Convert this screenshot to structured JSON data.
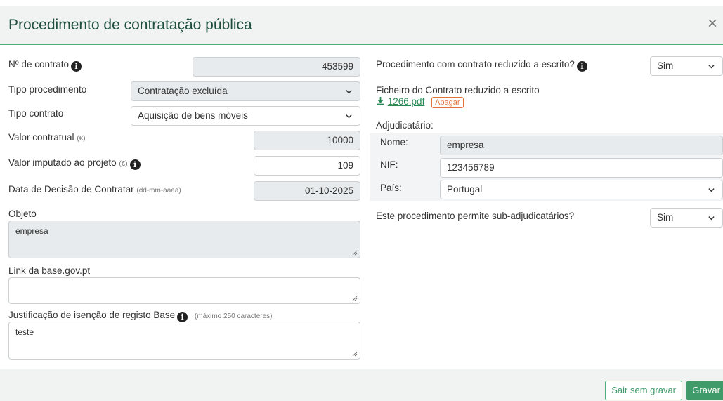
{
  "dialog": {
    "title": "Procedimento de contratação pública",
    "close_glyph": "×"
  },
  "left": {
    "contract_no": {
      "label": "Nº de contrato",
      "value": "453599"
    },
    "proc_type": {
      "label": "Tipo procedimento",
      "value": "Contratação excluída"
    },
    "contract_type": {
      "label": "Tipo contrato",
      "value": "Aquisição de bens móveis"
    },
    "contract_value": {
      "label": "Valor contratual",
      "unit": "(€)",
      "value": "10000"
    },
    "imputed_value": {
      "label": "Valor imputado ao projeto",
      "unit": "(€)",
      "value": "109"
    },
    "decision_date": {
      "label": "Data de Decisão de Contratar",
      "hint": "(dd-mm-aaaa)",
      "value": "01-10-2025"
    },
    "object": {
      "label": "Objeto",
      "value": "empresa"
    },
    "base_link": {
      "label": "Link da base.gov.pt",
      "value": ""
    },
    "justification": {
      "label": "Justificação de isenção de registo Base",
      "hint": "(máximo 250 caracteres)",
      "value": "teste"
    }
  },
  "right": {
    "written_contract": {
      "label": "Procedimento com contrato reduzido a escrito?",
      "value": "Sim"
    },
    "contract_file": {
      "label": "Ficheiro do Contrato reduzido a escrito",
      "file_name": "1266.pdf",
      "delete_label": "Apagar"
    },
    "awardee": {
      "label": "Adjudicatário:",
      "name": {
        "label": "Nome:",
        "value": "empresa"
      },
      "nif": {
        "label": "NIF:",
        "value": "123456789"
      },
      "country": {
        "label": "País:",
        "value": "Portugal"
      }
    },
    "sub_awardees": {
      "label": "Este procedimento permite sub-adjudicatários?",
      "value": "Sim"
    }
  },
  "footer": {
    "exit_label": "Sair sem gravar",
    "save_label": "Gravar"
  },
  "colors": {
    "accent": "#3f9b6a",
    "danger": "#e0733a",
    "readonly_bg": "#e8ebed"
  },
  "icons": [
    "info-icon",
    "chevron-down-icon",
    "download-icon",
    "close-icon",
    "resize-grip-icon"
  ]
}
